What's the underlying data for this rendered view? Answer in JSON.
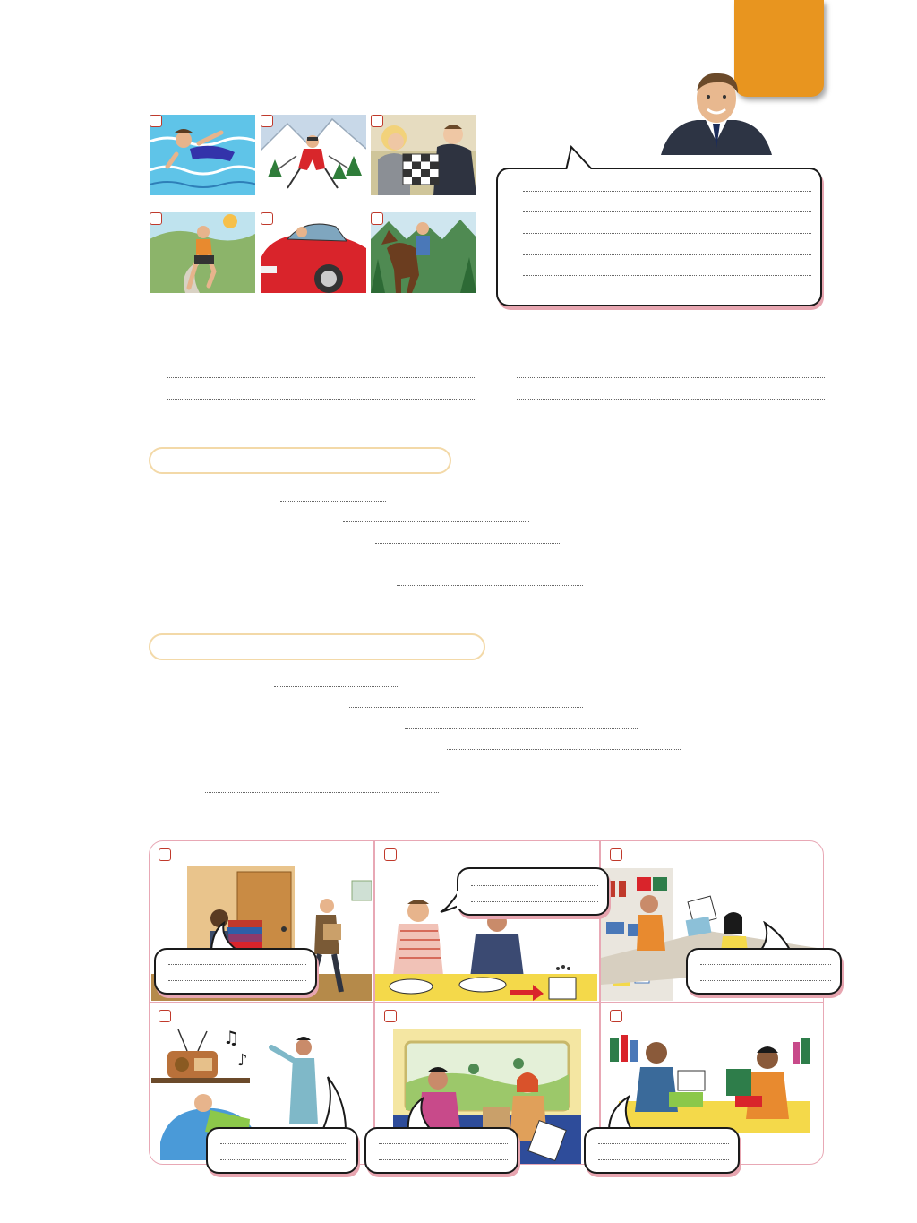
{
  "page": {
    "tab_color": "#e8951f",
    "accent_color": "#c0392b",
    "pill_border_color": "#f3d9a8",
    "grid_border_color": "#e8a8b5"
  },
  "activity_pictures": [
    {
      "icon": "swimming-icon"
    },
    {
      "icon": "skiing-icon"
    },
    {
      "icon": "chess-icon"
    },
    {
      "icon": "running-icon"
    },
    {
      "icon": "car-icon"
    },
    {
      "icon": "horse-riding-icon"
    }
  ],
  "speaker": {
    "icon": "man-in-suit-portrait"
  },
  "scenes": [
    {
      "icon": "carrying-books-scene"
    },
    {
      "icon": "dinner-table-scene"
    },
    {
      "icon": "souvenir-shop-scene"
    },
    {
      "icon": "loud-radio-scene"
    },
    {
      "icon": "train-journey-scene"
    },
    {
      "icon": "library-desk-scene"
    }
  ]
}
